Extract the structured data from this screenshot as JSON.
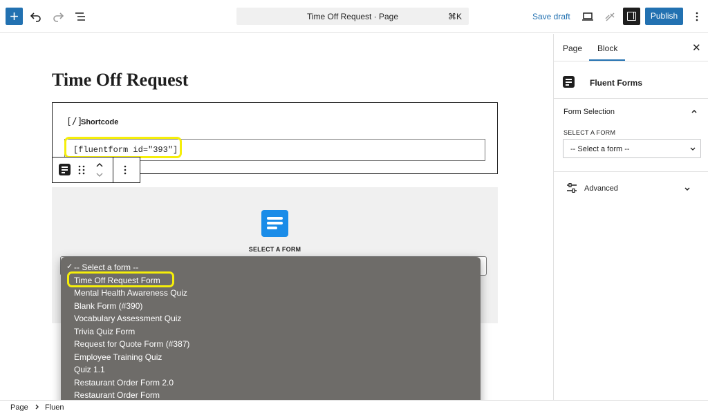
{
  "toolbar": {
    "add_label": "+",
    "document_title": "Time Off Request · Page",
    "command_shortcut": "⌘K",
    "save_draft": "Save draft",
    "publish": "Publish"
  },
  "editor": {
    "post_title": "Time Off Request",
    "shortcode_block": {
      "icon_glyph": "[/]",
      "label": "Shortcode",
      "value": "[fluentform id=\"393\"]"
    },
    "fluent_forms_block": {
      "select_label": "SELECT A FORM"
    },
    "dropdown": {
      "selected_check": "✓",
      "options": [
        "-- Select a form --",
        "Time Off Request Form",
        "Mental Health Awareness Quiz",
        "Blank Form (#390)",
        "Vocabulary Assessment Quiz",
        "Trivia Quiz Form",
        "Request for Quote Form (#387)",
        "Employee Training Quiz",
        "Quiz 1.1",
        "Restaurant Order Form 2.0",
        "Restaurant Order Form"
      ]
    }
  },
  "footer": {
    "breadcrumb": [
      "Page",
      "Fluen"
    ]
  },
  "sidebar": {
    "tabs": [
      "Page",
      "Block"
    ],
    "active_tab": "Block",
    "close_glyph": "✕",
    "block_name": "Fluent Forms",
    "form_selection_title": "Form Selection",
    "select_form_label": "SELECT A FORM",
    "select_value": "-- Select a form --",
    "advanced_title": "Advanced"
  },
  "colors": {
    "accent": "#2271b1",
    "highlight": "#f5ee0a",
    "dropdown_bg": "#6e6c69",
    "fluent_logo": "#1a8ce8"
  }
}
